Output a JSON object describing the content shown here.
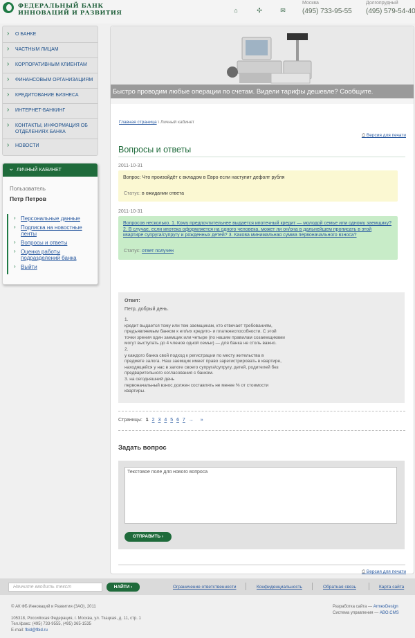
{
  "header": {
    "logo_line1": "ФЕДЕРАЛЬНЫЙ БАНК",
    "logo_line2": "ИННОВАЦИЙ И РАЗВИТИЯ",
    "icons": [
      "home-icon",
      "sitemap-icon",
      "mail-icon"
    ],
    "city1": "Москва",
    "phone1": "(495) 733-95-55",
    "city2": "Долгопрудный",
    "phone2": "(495) 579-54-40"
  },
  "sidebar": {
    "menu": [
      "О БАНКЕ",
      "ЧАСТНЫМ ЛИЦАМ",
      "КОРПОРАТИВНЫМ КЛИЕНТАМ",
      "ФИНАНСОВЫМ ОРГАНИЗАЦИЯМ",
      "КРЕДИТОВАНИЕ БИЗНЕСА",
      "ИНТЕРНЕТ-БАНКИНГ",
      "КОНТАКТЫ, ИНФОРМАЦИЯ ОБ ОТДЕЛЕНИЯХ БАНКА",
      "НОВОСТИ"
    ],
    "cabinet": {
      "title": "ЛИЧНЫЙ КАБИНЕТ",
      "user_label": "Пользователь",
      "user_name": "Петр Петров",
      "links": [
        "Персональные данные",
        "Подписка на новостные ленты",
        "Вопросы и ответы",
        "Оценка работы подразделений банка",
        "Выйти"
      ]
    }
  },
  "banner": {
    "text": "Быстро проводим любые операции по счетам. Видели тарифы дешевле? Сообщите."
  },
  "breadcrumb": {
    "home": "Главная страница",
    "sep": "\\",
    "current": "Личный кабинет"
  },
  "print_label": "Версия для печати",
  "page_title": "Вопросы и ответы",
  "questions": [
    {
      "date": "2011-10-31",
      "text": "Вопрос: Что произойдёт с вкладом в Евро если наступит дефолт рубля",
      "status_label": "Статус:",
      "status_value": "в ожидании ответа"
    },
    {
      "date": "2011-10-31",
      "text": "Вопросов несколько. 1. Кому предпочтительнее выдается ипотечный кредит — молодой семье или одному заемщику? 2. В случае, если ипотека оформляется на одного человека, может ли он/она в дальнейшем прописать в этой квартире супруга/супругу и рожденных детей? 3. Какова минимальная сумма первоначального взноса?",
      "status_label": "Статус:",
      "status_value": "ответ получен"
    }
  ],
  "answer": {
    "label": "Ответ:",
    "greeting": "Петр, добрый день.",
    "body": "1.\nкредит выдается тому или тем заемщикам, кто отвечает требованиям,\nпредъявляемым банком к его\\их кредито- и платежеспособности. С этой\nточки зрения один заемщик или четыре (по нашим правилам созаемщиками\nмогут выступать до 4 членов одной семьи) — для банка не столь важно.\n2.\nу каждого банка свой подход к регистрации по месту жительства в\nпредмете залога. Наш заемщик имеет право зарегистрировать в квартире,\nнаходящейся у нас в залоге своего супруга\\супругу, детей, родителей без\nпредварительного согласования с банком.\n3. на сегодняшний день\nпервоначальный взнос должен составлять не менее % от стоимости\nквартиры."
  },
  "pagination": {
    "label": "Страницы:",
    "pages": [
      "1",
      "2",
      "3",
      "4",
      "5",
      "6",
      "7",
      "→",
      "»"
    ],
    "current": "1"
  },
  "ask": {
    "title": "Задать вопрос",
    "textarea_value": "Текстовое поле для нового вопроса",
    "button": "ОТПРАВИТЬ ›"
  },
  "footer": {
    "search_placeholder": "Начните вводить текст",
    "find_button": "НАЙТИ ›",
    "links": [
      "Ограничение ответственности",
      "Конфиденциальность",
      "Обратная связь",
      "Карта сайта"
    ],
    "copyright": "© АК ФБ Инноваций и Развития (ЗАО), 2011",
    "address": "105318, Российская Федерация, г. Москва, ул. Ткацкая, д. 11, стр. 1",
    "phones": "Тел./факс: (495) 733-9555, (495) 365-1535",
    "email_label": "E-mail:",
    "email": "fbid@fbid.ru",
    "dev_label": "Разработка сайта —",
    "dev_link": "ArmexDesign",
    "cms_label": "Система управления —",
    "cms_link": "ABO.CMS"
  },
  "colors": {
    "brand_green": "#1f6b3b",
    "question_pending_bg": "#fbf8d2",
    "question_answered_bg": "#c8ecc8",
    "link_blue": "#2a5aa0"
  }
}
